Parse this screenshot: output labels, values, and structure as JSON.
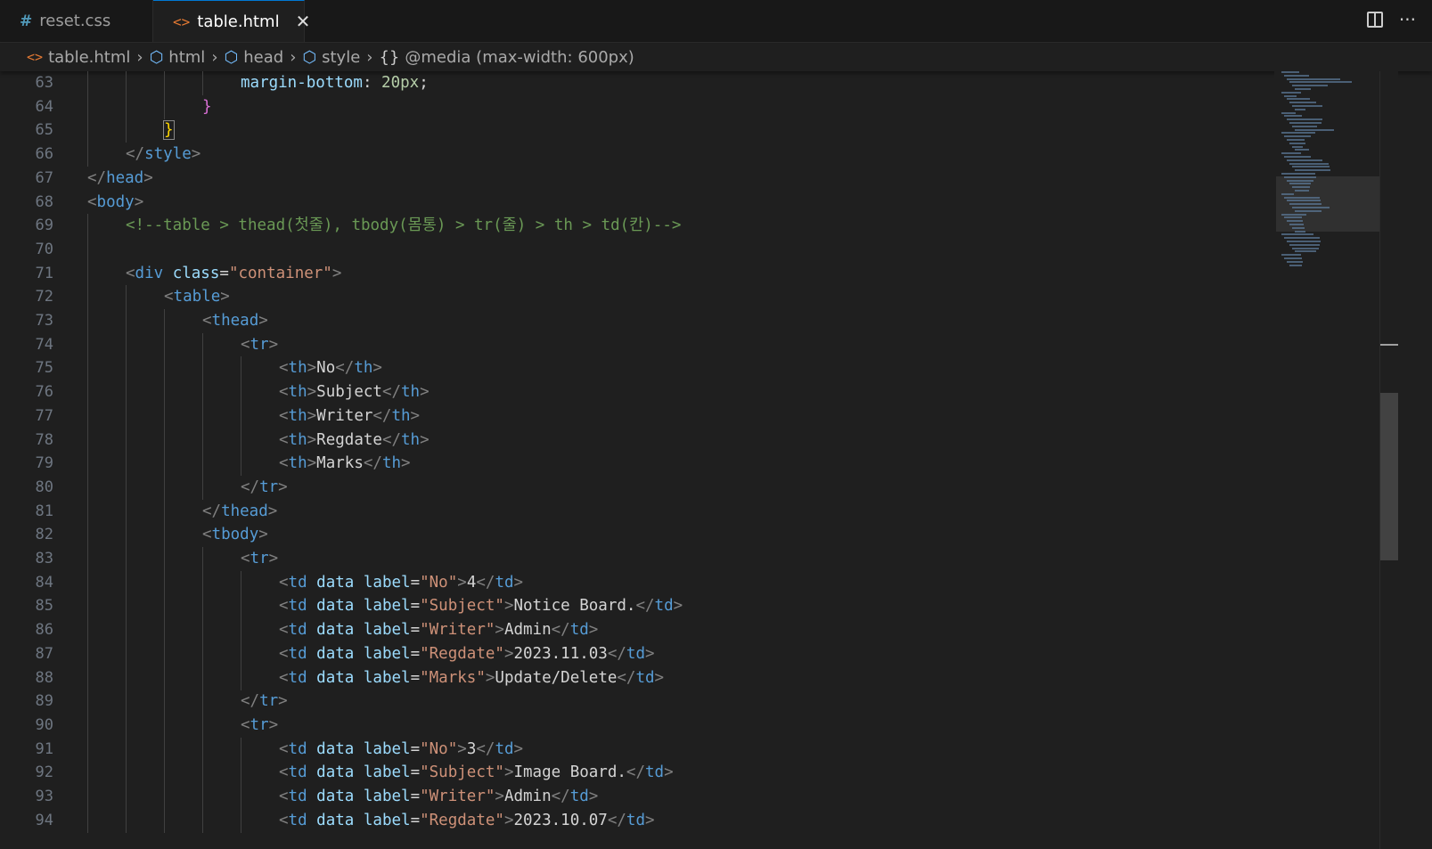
{
  "tabs": [
    {
      "icon": "#",
      "label": "reset.css",
      "active": false
    },
    {
      "icon": "<>",
      "label": "table.html",
      "active": true,
      "close": "✕"
    }
  ],
  "tab_actions": {
    "more": "···"
  },
  "breadcrumb": [
    {
      "icon": "<>",
      "label": "table.html"
    },
    {
      "icon": "cube",
      "label": "html"
    },
    {
      "icon": "cube",
      "label": "head"
    },
    {
      "icon": "cube",
      "label": "style"
    },
    {
      "icon": "{}",
      "label": "@media (max-width: 600px)"
    }
  ],
  "colors": {
    "accent": "#0078d4",
    "html_icon": "#e37933",
    "css_icon": "#519aba"
  },
  "lines": [
    {
      "n": "63",
      "indent": 4,
      "tokens": [
        [
          "prop",
          "margin-bottom"
        ],
        [
          "txt",
          ": "
        ],
        [
          "num",
          "20px"
        ],
        [
          "txt",
          ";"
        ]
      ]
    },
    {
      "n": "64",
      "indent": 3,
      "tokens": [
        [
          "curly-p",
          "}"
        ]
      ]
    },
    {
      "n": "65",
      "indent": 2,
      "tokens": [
        [
          "curly-y",
          "}"
        ]
      ]
    },
    {
      "n": "66",
      "indent": 1,
      "tokens": [
        [
          "bracket",
          "</"
        ],
        [
          "tag",
          "style"
        ],
        [
          "bracket",
          ">"
        ]
      ]
    },
    {
      "n": "67",
      "indent": 0,
      "tokens": [
        [
          "bracket",
          "</"
        ],
        [
          "tag",
          "head"
        ],
        [
          "bracket",
          ">"
        ]
      ]
    },
    {
      "n": "68",
      "indent": 0,
      "tokens": [
        [
          "bracket",
          "<"
        ],
        [
          "tag",
          "body"
        ],
        [
          "bracket",
          ">"
        ]
      ]
    },
    {
      "n": "69",
      "indent": 1,
      "tokens": [
        [
          "comment",
          "<!--table > thead(첫줄), tbody(몸통) > tr(줄) > th > td(칸)-->"
        ]
      ]
    },
    {
      "n": "70",
      "indent": 1,
      "tokens": []
    },
    {
      "n": "71",
      "indent": 1,
      "tokens": [
        [
          "bracket",
          "<"
        ],
        [
          "tag",
          "div"
        ],
        [
          "txt",
          " "
        ],
        [
          "attr",
          "class"
        ],
        [
          "txt",
          "="
        ],
        [
          "str",
          "\"container\""
        ],
        [
          "bracket",
          ">"
        ]
      ]
    },
    {
      "n": "72",
      "indent": 2,
      "tokens": [
        [
          "bracket",
          "<"
        ],
        [
          "tag",
          "table"
        ],
        [
          "bracket",
          ">"
        ]
      ]
    },
    {
      "n": "73",
      "indent": 3,
      "tokens": [
        [
          "bracket",
          "<"
        ],
        [
          "tag",
          "thead"
        ],
        [
          "bracket",
          ">"
        ]
      ]
    },
    {
      "n": "74",
      "indent": 4,
      "tokens": [
        [
          "bracket",
          "<"
        ],
        [
          "tag",
          "tr"
        ],
        [
          "bracket",
          ">"
        ]
      ]
    },
    {
      "n": "75",
      "indent": 5,
      "tokens": [
        [
          "bracket",
          "<"
        ],
        [
          "tag",
          "th"
        ],
        [
          "bracket",
          ">"
        ],
        [
          "txt",
          "No"
        ],
        [
          "bracket",
          "</"
        ],
        [
          "tag",
          "th"
        ],
        [
          "bracket",
          ">"
        ]
      ]
    },
    {
      "n": "76",
      "indent": 5,
      "tokens": [
        [
          "bracket",
          "<"
        ],
        [
          "tag",
          "th"
        ],
        [
          "bracket",
          ">"
        ],
        [
          "txt",
          "Subject"
        ],
        [
          "bracket",
          "</"
        ],
        [
          "tag",
          "th"
        ],
        [
          "bracket",
          ">"
        ]
      ]
    },
    {
      "n": "77",
      "indent": 5,
      "tokens": [
        [
          "bracket",
          "<"
        ],
        [
          "tag",
          "th"
        ],
        [
          "bracket",
          ">"
        ],
        [
          "txt",
          "Writer"
        ],
        [
          "bracket",
          "</"
        ],
        [
          "tag",
          "th"
        ],
        [
          "bracket",
          ">"
        ]
      ]
    },
    {
      "n": "78",
      "indent": 5,
      "tokens": [
        [
          "bracket",
          "<"
        ],
        [
          "tag",
          "th"
        ],
        [
          "bracket",
          ">"
        ],
        [
          "txt",
          "Regdate"
        ],
        [
          "bracket",
          "</"
        ],
        [
          "tag",
          "th"
        ],
        [
          "bracket",
          ">"
        ]
      ]
    },
    {
      "n": "79",
      "indent": 5,
      "tokens": [
        [
          "bracket",
          "<"
        ],
        [
          "tag",
          "th"
        ],
        [
          "bracket",
          ">"
        ],
        [
          "txt",
          "Marks"
        ],
        [
          "bracket",
          "</"
        ],
        [
          "tag",
          "th"
        ],
        [
          "bracket",
          ">"
        ]
      ]
    },
    {
      "n": "80",
      "indent": 4,
      "tokens": [
        [
          "bracket",
          "</"
        ],
        [
          "tag",
          "tr"
        ],
        [
          "bracket",
          ">"
        ]
      ]
    },
    {
      "n": "81",
      "indent": 3,
      "tokens": [
        [
          "bracket",
          "</"
        ],
        [
          "tag",
          "thead"
        ],
        [
          "bracket",
          ">"
        ]
      ]
    },
    {
      "n": "82",
      "indent": 3,
      "tokens": [
        [
          "bracket",
          "<"
        ],
        [
          "tag",
          "tbody"
        ],
        [
          "bracket",
          ">"
        ]
      ]
    },
    {
      "n": "83",
      "indent": 4,
      "tokens": [
        [
          "bracket",
          "<"
        ],
        [
          "tag",
          "tr"
        ],
        [
          "bracket",
          ">"
        ]
      ]
    },
    {
      "n": "84",
      "indent": 5,
      "tokens": [
        [
          "bracket",
          "<"
        ],
        [
          "tag",
          "td"
        ],
        [
          "txt",
          " "
        ],
        [
          "attr",
          "data"
        ],
        [
          "txt",
          " "
        ],
        [
          "attr",
          "label"
        ],
        [
          "txt",
          "="
        ],
        [
          "str",
          "\"No\""
        ],
        [
          "bracket",
          ">"
        ],
        [
          "txt",
          "4"
        ],
        [
          "bracket",
          "</"
        ],
        [
          "tag",
          "td"
        ],
        [
          "bracket",
          ">"
        ]
      ]
    },
    {
      "n": "85",
      "indent": 5,
      "tokens": [
        [
          "bracket",
          "<"
        ],
        [
          "tag",
          "td"
        ],
        [
          "txt",
          " "
        ],
        [
          "attr",
          "data"
        ],
        [
          "txt",
          " "
        ],
        [
          "attr",
          "label"
        ],
        [
          "txt",
          "="
        ],
        [
          "str",
          "\"Subject\""
        ],
        [
          "bracket",
          ">"
        ],
        [
          "txt",
          "Notice Board."
        ],
        [
          "bracket",
          "</"
        ],
        [
          "tag",
          "td"
        ],
        [
          "bracket",
          ">"
        ]
      ]
    },
    {
      "n": "86",
      "indent": 5,
      "tokens": [
        [
          "bracket",
          "<"
        ],
        [
          "tag",
          "td"
        ],
        [
          "txt",
          " "
        ],
        [
          "attr",
          "data"
        ],
        [
          "txt",
          " "
        ],
        [
          "attr",
          "label"
        ],
        [
          "txt",
          "="
        ],
        [
          "str",
          "\"Writer\""
        ],
        [
          "bracket",
          ">"
        ],
        [
          "txt",
          "Admin"
        ],
        [
          "bracket",
          "</"
        ],
        [
          "tag",
          "td"
        ],
        [
          "bracket",
          ">"
        ]
      ]
    },
    {
      "n": "87",
      "indent": 5,
      "tokens": [
        [
          "bracket",
          "<"
        ],
        [
          "tag",
          "td"
        ],
        [
          "txt",
          " "
        ],
        [
          "attr",
          "data"
        ],
        [
          "txt",
          " "
        ],
        [
          "attr",
          "label"
        ],
        [
          "txt",
          "="
        ],
        [
          "str",
          "\"Regdate\""
        ],
        [
          "bracket",
          ">"
        ],
        [
          "txt",
          "2023.11.03"
        ],
        [
          "bracket",
          "</"
        ],
        [
          "tag",
          "td"
        ],
        [
          "bracket",
          ">"
        ]
      ]
    },
    {
      "n": "88",
      "indent": 5,
      "tokens": [
        [
          "bracket",
          "<"
        ],
        [
          "tag",
          "td"
        ],
        [
          "txt",
          " "
        ],
        [
          "attr",
          "data"
        ],
        [
          "txt",
          " "
        ],
        [
          "attr",
          "label"
        ],
        [
          "txt",
          "="
        ],
        [
          "str",
          "\"Marks\""
        ],
        [
          "bracket",
          ">"
        ],
        [
          "txt",
          "Update/Delete"
        ],
        [
          "bracket",
          "</"
        ],
        [
          "tag",
          "td"
        ],
        [
          "bracket",
          ">"
        ]
      ]
    },
    {
      "n": "89",
      "indent": 4,
      "tokens": [
        [
          "bracket",
          "</"
        ],
        [
          "tag",
          "tr"
        ],
        [
          "bracket",
          ">"
        ]
      ]
    },
    {
      "n": "90",
      "indent": 4,
      "tokens": [
        [
          "bracket",
          "<"
        ],
        [
          "tag",
          "tr"
        ],
        [
          "bracket",
          ">"
        ]
      ]
    },
    {
      "n": "91",
      "indent": 5,
      "tokens": [
        [
          "bracket",
          "<"
        ],
        [
          "tag",
          "td"
        ],
        [
          "txt",
          " "
        ],
        [
          "attr",
          "data"
        ],
        [
          "txt",
          " "
        ],
        [
          "attr",
          "label"
        ],
        [
          "txt",
          "="
        ],
        [
          "str",
          "\"No\""
        ],
        [
          "bracket",
          ">"
        ],
        [
          "txt",
          "3"
        ],
        [
          "bracket",
          "</"
        ],
        [
          "tag",
          "td"
        ],
        [
          "bracket",
          ">"
        ]
      ]
    },
    {
      "n": "92",
      "indent": 5,
      "tokens": [
        [
          "bracket",
          "<"
        ],
        [
          "tag",
          "td"
        ],
        [
          "txt",
          " "
        ],
        [
          "attr",
          "data"
        ],
        [
          "txt",
          " "
        ],
        [
          "attr",
          "label"
        ],
        [
          "txt",
          "="
        ],
        [
          "str",
          "\"Subject\""
        ],
        [
          "bracket",
          ">"
        ],
        [
          "txt",
          "Image Board."
        ],
        [
          "bracket",
          "</"
        ],
        [
          "tag",
          "td"
        ],
        [
          "bracket",
          ">"
        ]
      ]
    },
    {
      "n": "93",
      "indent": 5,
      "tokens": [
        [
          "bracket",
          "<"
        ],
        [
          "tag",
          "td"
        ],
        [
          "txt",
          " "
        ],
        [
          "attr",
          "data"
        ],
        [
          "txt",
          " "
        ],
        [
          "attr",
          "label"
        ],
        [
          "txt",
          "="
        ],
        [
          "str",
          "\"Writer\""
        ],
        [
          "bracket",
          ">"
        ],
        [
          "txt",
          "Admin"
        ],
        [
          "bracket",
          "</"
        ],
        [
          "tag",
          "td"
        ],
        [
          "bracket",
          ">"
        ]
      ]
    },
    {
      "n": "94",
      "indent": 5,
      "tokens": [
        [
          "bracket",
          "<"
        ],
        [
          "tag",
          "td"
        ],
        [
          "txt",
          " "
        ],
        [
          "attr",
          "data"
        ],
        [
          "txt",
          " "
        ],
        [
          "attr",
          "label"
        ],
        [
          "txt",
          "="
        ],
        [
          "str",
          "\"Regdate\""
        ],
        [
          "bracket",
          ">"
        ],
        [
          "txt",
          "2023.10.07"
        ],
        [
          "bracket",
          "</"
        ],
        [
          "tag",
          "td"
        ],
        [
          "bracket",
          ">"
        ]
      ]
    }
  ]
}
